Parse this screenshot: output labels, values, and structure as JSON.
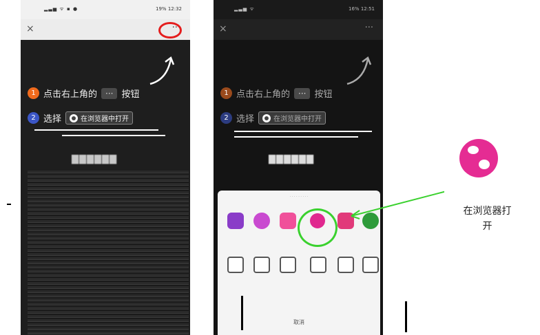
{
  "phone1": {
    "status_time": "12:32",
    "battery": "19%",
    "step1_text": "点击右上角的",
    "step1_suffix": "按钮",
    "more_label": "···",
    "step2_text": "选择",
    "open_label": "在浏览器中打开",
    "close_label": "×"
  },
  "phone2": {
    "status_time": "12:51",
    "battery": "16%",
    "step1_text": "点击右上角的",
    "step1_suffix": "按钮",
    "more_label": "···",
    "step2_text": "选择",
    "open_label": "在浏览器中打开",
    "close_label": "×",
    "sheet_cancel": "取消"
  },
  "callout": {
    "label_line1": "在浏览器打",
    "label_line2": "开"
  },
  "colors": {
    "red_highlight": "#e41e1e",
    "green_highlight": "#3ad12e",
    "magenta_icon": "#e52c93",
    "step1_badge": "#f06a1c",
    "step2_badge": "#3b56c6"
  }
}
